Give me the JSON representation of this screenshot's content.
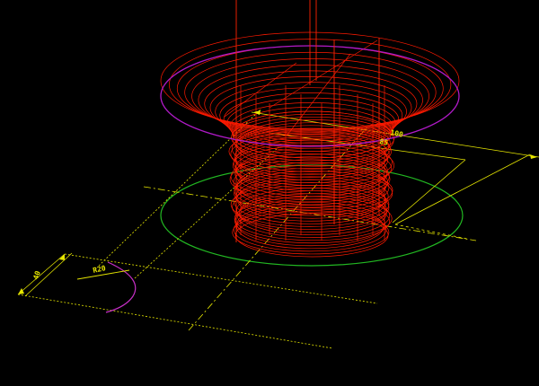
{
  "dimensions": {
    "outer_diameter": "100",
    "inner_diameter": "85",
    "height": "40",
    "fillet_radius": "R20"
  },
  "colors": {
    "background": "#000000",
    "toolpath": "#ff1a00",
    "toolpath_dense": "#ff2200",
    "top_circle": "#b01ac8",
    "bottom_circle": "#22b822",
    "dimension": "#e6e600",
    "dimension_dotted": "#d8d860",
    "arc": "#c830c8"
  }
}
